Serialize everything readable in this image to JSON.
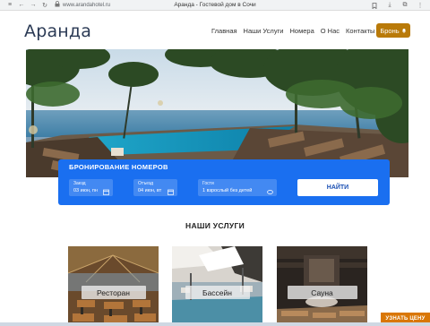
{
  "browser": {
    "url": "www.arandahotel.ru",
    "tab_title": "Аранда - Гостевой дом в Сочи"
  },
  "header": {
    "logo": "Аранда",
    "nav": [
      "Главная",
      "Наши Услуги",
      "Номера",
      "О Нас",
      "Контакты"
    ],
    "book_button": "Бронь"
  },
  "booking": {
    "title": "БРОНИРОВАНИЕ НОМЕРОВ",
    "checkin_label": "Заезд",
    "checkin_value": "03 июн, пн",
    "checkout_label": "Отъезд",
    "checkout_value": "04 июн, вт",
    "guests_label": "Гости",
    "guests_value": "1 взрослый без детей",
    "search_button": "НАЙТИ"
  },
  "services": {
    "title": "НАШИ УСЛУГИ",
    "cards": [
      {
        "label": "Ресторан"
      },
      {
        "label": "Бассейн"
      },
      {
        "label": "Сауна"
      }
    ]
  },
  "float_button": "УЗНАТЬ ЦЕНУ",
  "colors": {
    "accent_blue": "#1a6ff0",
    "brand_gold": "#b97a09",
    "price_orange": "#d97706",
    "logo_navy": "#2b3a55"
  }
}
